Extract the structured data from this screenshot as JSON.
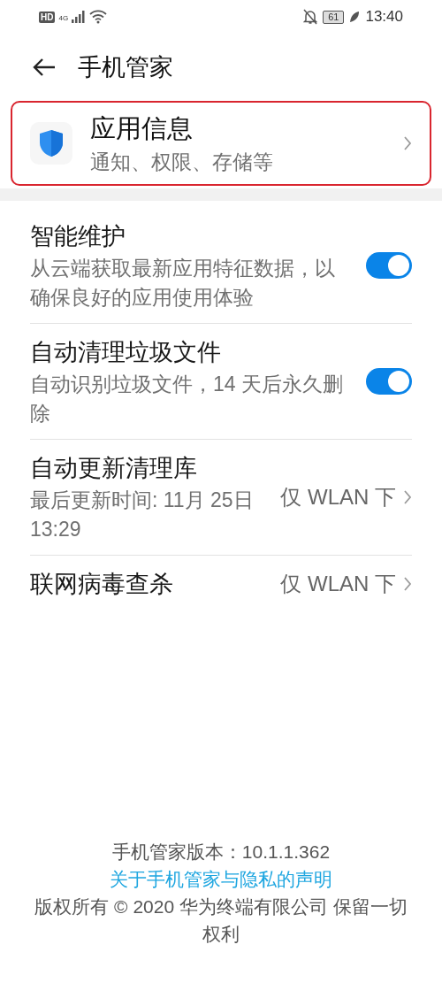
{
  "status_bar": {
    "network_badge": "HD",
    "network_type": "4G",
    "battery": "61",
    "time": "13:40"
  },
  "header": {
    "title": "手机管家"
  },
  "app_info": {
    "title": "应用信息",
    "subtitle": "通知、权限、存储等"
  },
  "settings": [
    {
      "kind": "toggle",
      "title": "智能维护",
      "description": "从云端获取最新应用特征数据，以确保良好的应用使用体验",
      "on": true
    },
    {
      "kind": "toggle",
      "title": "自动清理垃圾文件",
      "description": "自动识别垃圾文件，14 天后永久删除",
      "on": true
    },
    {
      "kind": "link",
      "title": "自动更新清理库",
      "description": "最后更新时间: 11月 25日 13:29",
      "value": "仅 WLAN 下"
    },
    {
      "kind": "link",
      "title": "联网病毒查杀",
      "value": "仅 WLAN 下"
    }
  ],
  "footer": {
    "version": "手机管家版本：10.1.1.362",
    "privacy_link": "关于手机管家与隐私的声明",
    "copyright": "版权所有 © 2020 华为终端有限公司 保留一切权利"
  }
}
